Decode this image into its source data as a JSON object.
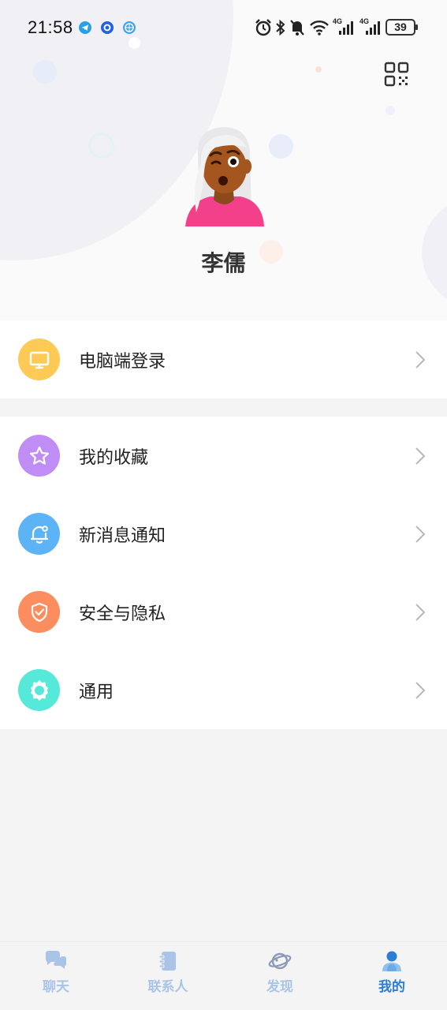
{
  "status_bar": {
    "time": "21:58",
    "battery": "39",
    "network_1": "4G",
    "network_2": "4G"
  },
  "profile": {
    "username": "李儒",
    "qr_icon": "qr-code-icon"
  },
  "menu": {
    "group1": [
      {
        "label": "电脑端登录",
        "icon": "monitor-icon",
        "color": "#fcca55"
      }
    ],
    "group2": [
      {
        "label": "我的收藏",
        "icon": "star-icon",
        "color": "#c08cf6"
      },
      {
        "label": "新消息通知",
        "icon": "bell-icon",
        "color": "#5cb3f5"
      },
      {
        "label": "安全与隐私",
        "icon": "shield-icon",
        "color": "#fc8d5e"
      },
      {
        "label": "通用",
        "icon": "gear-icon",
        "color": "#56e8d9"
      }
    ]
  },
  "bottom_nav": {
    "items": [
      {
        "label": "聊天",
        "icon": "chat-icon"
      },
      {
        "label": "联系人",
        "icon": "contacts-icon"
      },
      {
        "label": "发现",
        "icon": "planet-icon"
      },
      {
        "label": "我的",
        "icon": "person-icon"
      }
    ],
    "active_index": 3,
    "active_color": "#2a7ed8",
    "inactive_color": "#a9c4e6"
  }
}
